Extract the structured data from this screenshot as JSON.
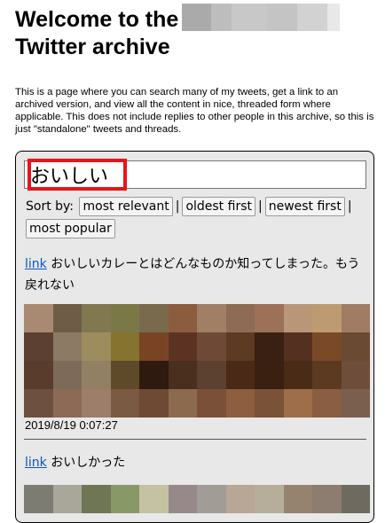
{
  "header": {
    "title_line1": "Welcome to the",
    "title_line2": "Twitter archive"
  },
  "intro": "This is a page where you can search many of my tweets, get a link to an archived version, and view all the content in nice, threaded form where applicable. This does not include replies to other people in this archive, so this is just \"standalone\" tweets and threads.",
  "search": {
    "value": "おいしい",
    "placeholder": ""
  },
  "sort": {
    "label": "Sort by:",
    "options": [
      "most relevant",
      "oldest first",
      "newest first",
      "most popular"
    ],
    "separator": "|"
  },
  "tweets": [
    {
      "link_label": "link",
      "text": "おいしいカレーとはどんなものか知ってしまった。もう戻れない",
      "date": "2019/8/19 0:07:27",
      "image_colors": [
        [
          "#a88a73",
          "#6e5c47",
          "#81784f",
          "#7b7848",
          "#7a6a4d",
          "#8b5c3e",
          "#a07f66",
          "#8e6b54",
          "#9d7158",
          "#b99677",
          "#be9a72",
          "#a07c65"
        ],
        [
          "#5c4132",
          "#8c7a64",
          "#9c8c5e",
          "#867330",
          "#7a4424",
          "#5c3322",
          "#6e4a36",
          "#5c3a24",
          "#3a2012",
          "#543020",
          "#7a4a28",
          "#6a4a33"
        ],
        [
          "#5a3c2c",
          "#7e6a58",
          "#918063",
          "#5e4a28",
          "#2e1a0e",
          "#4a2e1e",
          "#5c4030",
          "#4a2a16",
          "#3a2010",
          "#4a2c16",
          "#5c3a22",
          "#6e4e3a"
        ],
        [
          "#6e5040",
          "#8c6a56",
          "#9c7e6a",
          "#7a5a42",
          "#6e4a34",
          "#8c6a4e",
          "#7a5038",
          "#8e5e40",
          "#7a5238",
          "#9e6e4a",
          "#8a5e42",
          "#7a5e4e"
        ]
      ]
    },
    {
      "link_label": "link",
      "text": "おいしかった",
      "image_colors": [
        [
          "#7d7c72",
          "#a9a69a",
          "#6f7656",
          "#889866",
          "#c5c2a3",
          "#97898a",
          "#a29c96",
          "#b8a796",
          "#b6ae9b",
          "#958370",
          "#8d7c70",
          "#6e6a60"
        ]
      ]
    }
  ]
}
